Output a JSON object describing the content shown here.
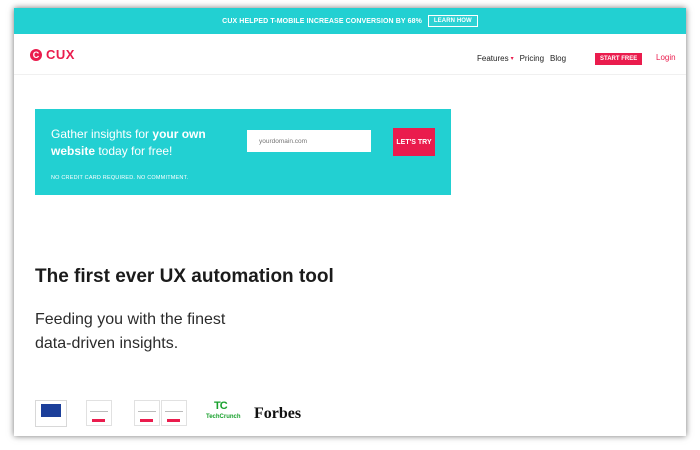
{
  "topbar": {
    "promo": "CUX HELPED T-MOBILE INCREASE CONVERSION BY 68%",
    "cta": "LEARN HOW"
  },
  "nav": {
    "logo_mark": "C",
    "logo_text": "CUX",
    "links": [
      "Features",
      "Pricing",
      "Blog"
    ],
    "start": "START FREE",
    "login": "Login"
  },
  "hero": {
    "line_plain_1": "Gather insights for ",
    "line_bold_1": "your own",
    "line_bold_2": "website",
    "line_plain_2": " today for free!",
    "placeholder": "yourdomain.com",
    "cta": "LET'S TRY",
    "note": "NO CREDIT CARD REQUIRED. NO COMMITMENT."
  },
  "headline": "The first ever UX automation tool",
  "subheadline_1": "Feeding you with the finest",
  "subheadline_2": "data-driven insights.",
  "press": {
    "techcrunch": "TechCrunch",
    "forbes": "Forbes"
  },
  "colors": {
    "accent": "#22d0d2",
    "brand": "#ea1c4d"
  }
}
